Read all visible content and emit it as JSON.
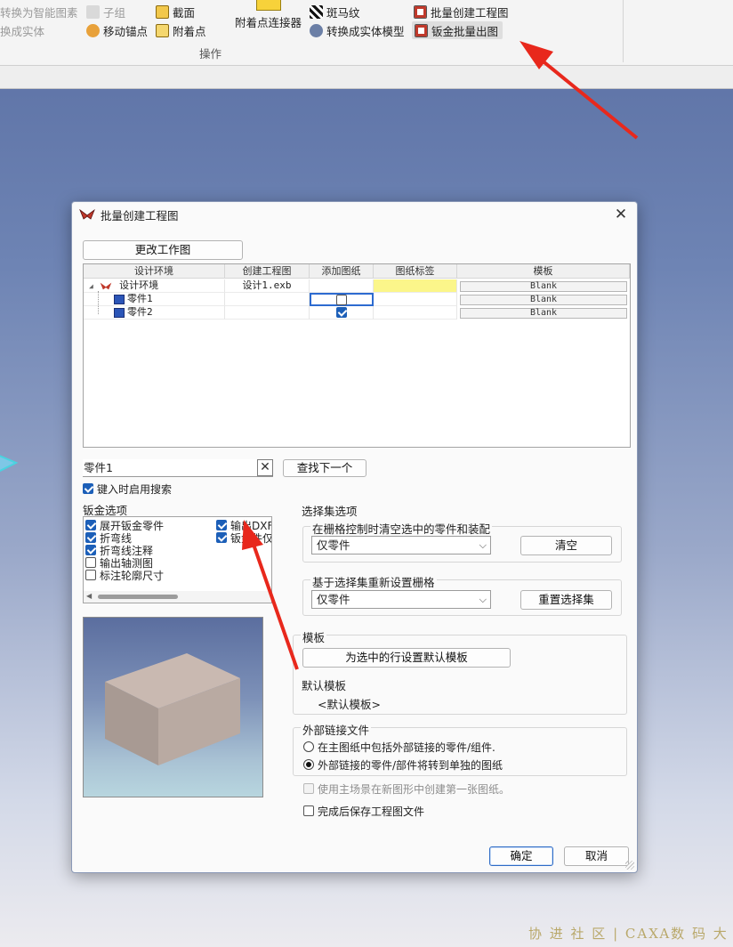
{
  "ribbon": {
    "items": {
      "to_smart_symbol": "转换为智能图素",
      "sub_group": "子组",
      "section": "截面",
      "attach_connector": "附着点连接器",
      "zebra": "斑马纹",
      "batch_drawing": "批量创建工程图",
      "to_solid": "换成实体",
      "move_anchor": "移动锚点",
      "attach_point": "附着点",
      "convert_solid_model": "转换成实体模型",
      "sheetmetal_batch": "钣金批量出图"
    },
    "group_label": "操作"
  },
  "dialog": {
    "title": "批量创建工程图",
    "close": "✕",
    "change_drawing_button": "更改工作图",
    "grid": {
      "headers": [
        "设计环境",
        "创建工程图",
        "添加图纸",
        "图纸标签",
        "模板"
      ],
      "rows": [
        {
          "name": "设计环境",
          "drawing": "设计1.exb",
          "template": "Blank"
        },
        {
          "name": "零件1",
          "drawing": "",
          "template": "Blank",
          "add_sheet": false
        },
        {
          "name": "零件2",
          "drawing": "",
          "template": "Blank",
          "add_sheet": true
        }
      ]
    },
    "search_value": "零件1",
    "search_clear": "✕",
    "find_next_button": "查找下一个",
    "enable_search_label": "键入时启用搜索",
    "enable_search_checked": true,
    "sheetmetal": {
      "title": "钣金选项",
      "options": [
        {
          "label": "展开钣金零件",
          "checked": true
        },
        {
          "label": "折弯线",
          "checked": true
        },
        {
          "label": "折弯线注释",
          "checked": true
        },
        {
          "label": "输出轴测图",
          "checked": false
        },
        {
          "label": "标注轮廓尺寸",
          "checked": false
        }
      ],
      "options_right": [
        {
          "label": "输出DXF",
          "checked": true
        },
        {
          "label": "钣金件仅",
          "checked": true
        }
      ]
    },
    "selection_set": {
      "title": "选择集选项",
      "clear_group_title": "在栅格控制时清空选中的零件和装配",
      "clear_select_value": "仅零件",
      "clear_button": "清空",
      "reset_group_title": "基于选择集重新设置栅格",
      "reset_select_value": "仅零件",
      "reset_button": "重置选择集"
    },
    "template": {
      "title": "模板",
      "set_default_button": "为选中的行设置默认模板",
      "default_label": "默认模板",
      "default_value": "<默认模板>"
    },
    "external_links": {
      "title": "外部链接文件",
      "option_include": "在主图纸中包括外部链接的零件/组件.",
      "option_separate": "外部链接的零件/部件将转到单独的图纸",
      "selected": "separate"
    },
    "use_main_scene_label": "使用主场景在新图形中创建第一张图纸。",
    "save_after_label": "完成后保存工程图文件",
    "ok_button": "确定",
    "cancel_button": "取消"
  },
  "watermark": "协  进  社  区  |  CAXA数  码  大  方",
  "colors": {
    "accent": "#1c5fb8",
    "viewport_top": "#5a6fa3",
    "arrow": "#e8281c",
    "highlight_cell": "#fbf68a"
  }
}
